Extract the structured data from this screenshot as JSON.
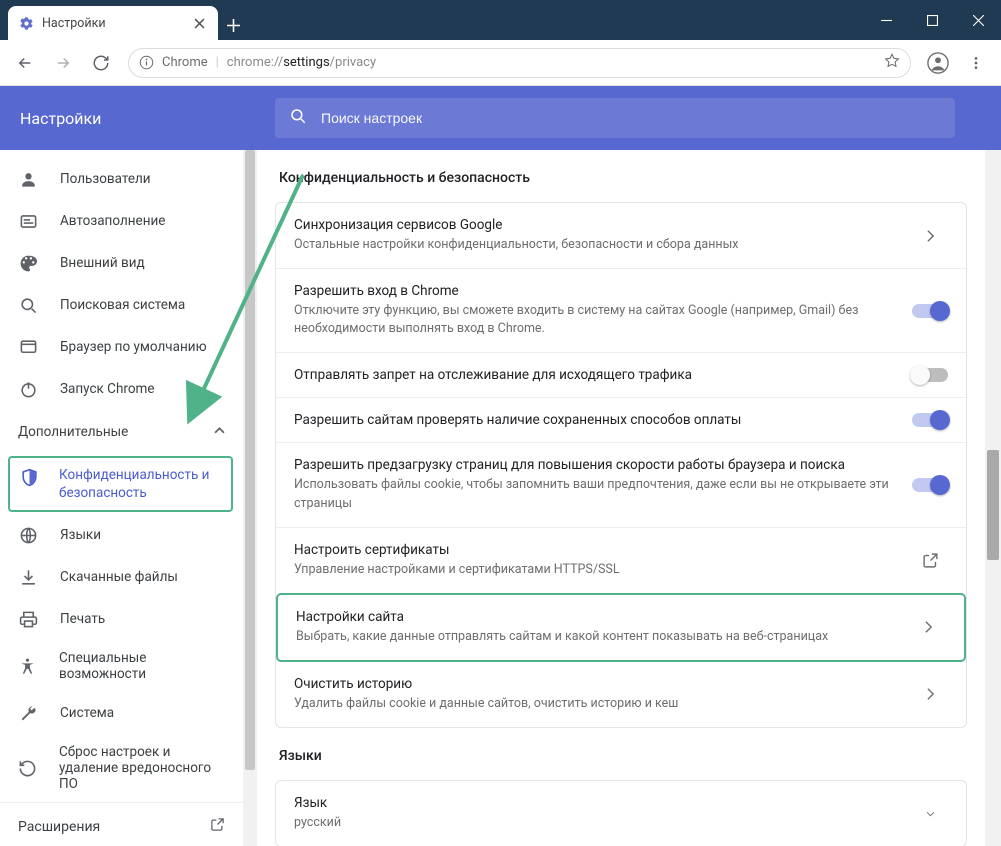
{
  "colors": {
    "accent": "#5868d1",
    "highlight": "#4fb288"
  },
  "window": {
    "tab_title": "Настройки"
  },
  "browser": {
    "url_label": "Chrome",
    "url_scheme": "chrome://",
    "url_host": "settings",
    "url_path": "/privacy"
  },
  "header": {
    "title": "Настройки",
    "search_placeholder": "Поиск настроек"
  },
  "sidebar": {
    "items": [
      {
        "label": "Пользователи"
      },
      {
        "label": "Автозаполнение"
      },
      {
        "label": "Внешний вид"
      },
      {
        "label": "Поисковая система"
      },
      {
        "label": "Браузер по умолчанию"
      },
      {
        "label": "Запуск Chrome"
      }
    ],
    "advanced_label": "Дополнительные",
    "advanced_items": [
      {
        "label": "Конфиденциальность и безопасность"
      },
      {
        "label": "Языки"
      },
      {
        "label": "Скачанные файлы"
      },
      {
        "label": "Печать"
      },
      {
        "label": "Специальные возможности"
      },
      {
        "label": "Система"
      },
      {
        "label": "Сброс настроек и удаление вредоносного ПО"
      }
    ],
    "extensions_label": "Расширения"
  },
  "main": {
    "section_title": "Конфиденциальность и безопасность",
    "rows": [
      {
        "title": "Синхронизация сервисов Google",
        "sub": "Остальные настройки конфиденциальности, безопасности и сбора данных",
        "action": "drill"
      },
      {
        "title": "Разрешить вход в Chrome",
        "sub": "Отключите эту функцию, вы сможете входить в систему на сайтах Google (например, Gmail) без необходимости выполнять вход в Chrome.",
        "action": "toggle_on"
      },
      {
        "title": "Отправлять запрет на отслеживание для исходящего трафика",
        "sub": "",
        "action": "toggle_off"
      },
      {
        "title": "Разрешить сайтам проверять наличие сохраненных способов оплаты",
        "sub": "",
        "action": "toggle_on"
      },
      {
        "title": "Разрешить предзагрузку страниц для повышения скорости работы браузера и поиска",
        "sub": "Использовать файлы cookie, чтобы запомнить ваши предпочтения, даже если вы не открываете эти страницы",
        "action": "toggle_on"
      },
      {
        "title": "Настроить сертификаты",
        "sub": "Управление настройками и сертификатами HTTPS/SSL",
        "action": "open"
      },
      {
        "title": "Настройки сайта",
        "sub": "Выбрать, какие данные отправлять сайтам и какой контент показывать на веб-страницах",
        "action": "drill"
      },
      {
        "title": "Очистить историю",
        "sub": "Удалить файлы cookie и данные сайтов, очистить историю и кеш",
        "action": "drill"
      }
    ],
    "lang_section_title": "Языки",
    "lang_row": {
      "title": "Язык",
      "sub": "русский"
    }
  }
}
